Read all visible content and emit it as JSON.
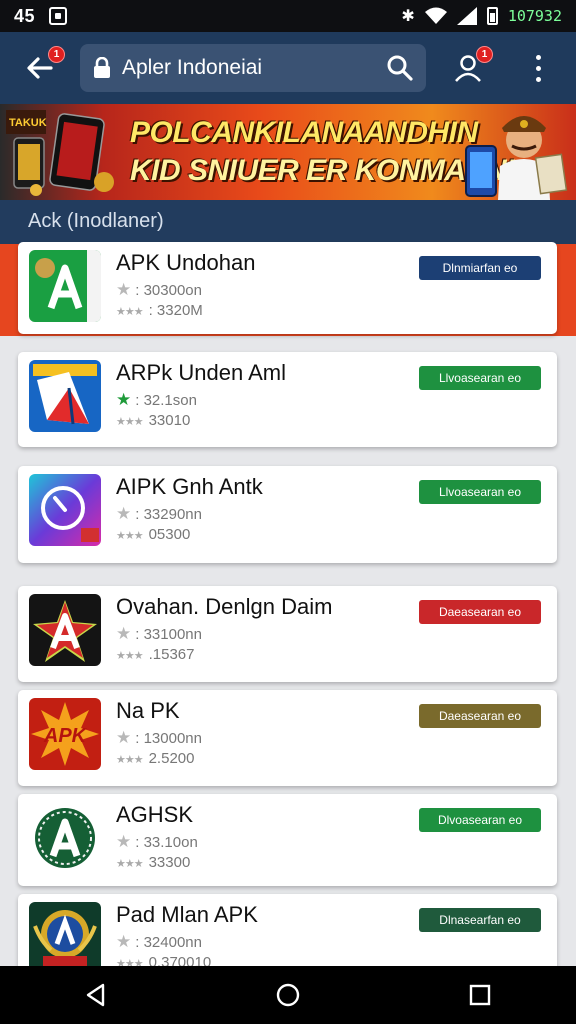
{
  "status": {
    "time": "45",
    "bluetooth_glyph": "✱",
    "code": "107932"
  },
  "toolbar": {
    "back_badge": "1",
    "search_text": "Apler Indoneiai",
    "profile_badge": "1"
  },
  "banner": {
    "line1": "POLCANKILANAANDHIN",
    "line2": "KID SNIUER ER KONMASNI",
    "corner_text": "TAKUK"
  },
  "section": {
    "title": "Ack  (Inodlaner)"
  },
  "apps": [
    {
      "name": "APK Undohan",
      "size": ": 30300on",
      "downloads": ": 3320M",
      "button": "Dlnmiarfan eo",
      "button_color": "#1c3f74",
      "icon": "green-a-icon",
      "star_green": false
    },
    {
      "name": "ARPk Unden Aml",
      "size": ": 32.1son",
      "downloads": "33010",
      "button": "Llvoasearan eo",
      "button_color": "#1e9140",
      "icon": "blue-paper-icon",
      "star_green": true
    },
    {
      "name": "AIPK Gnh Antk",
      "size": ": 33290nn",
      "downloads": "05300",
      "button": "Llvoasearan eo",
      "button_color": "#1e9140",
      "icon": "gradient-dial-icon",
      "star_green": false
    },
    {
      "name": "Ovahan. Denlgn Daim",
      "size": ": 33100nn",
      "downloads": ".15367",
      "button": "Daeasearan eo",
      "button_color": "#c9272a",
      "icon": "red-a-star-icon",
      "star_green": false
    },
    {
      "name": "Na PK",
      "size": ": 13000nn",
      "downloads": "2.5200",
      "button": "Daeasearan eo",
      "button_color": "#7a6a2c",
      "icon": "orange-burst-icon",
      "star_green": false
    },
    {
      "name": "AGHSK",
      "size": ": 33.10on",
      "downloads": "33300",
      "button": "Dlvoasearan eo",
      "button_color": "#1e9140",
      "icon": "green-circle-a-icon",
      "star_green": false
    },
    {
      "name": "Pad Mlan APK",
      "size": ": 32400nn",
      "downloads": "0.370010",
      "button": "Dlnasearfan eo",
      "button_color": "#1f5a3c",
      "icon": "gold-emblem-icon",
      "star_green": false
    }
  ]
}
